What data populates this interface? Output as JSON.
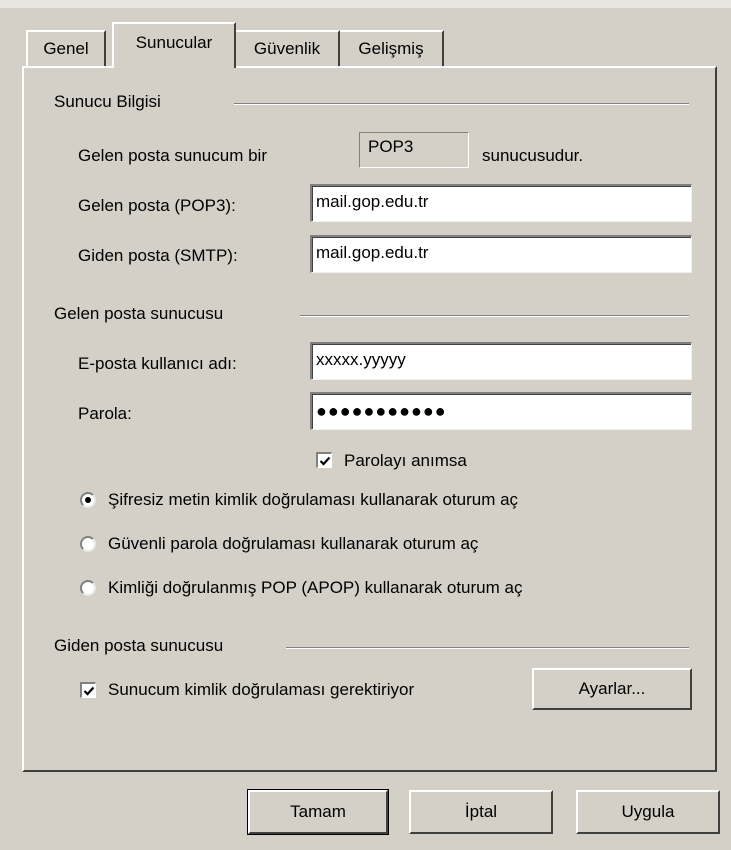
{
  "tabs": [
    {
      "label": "Genel",
      "active": false
    },
    {
      "label": "Sunucular",
      "active": true
    },
    {
      "label": "Güvenlik",
      "active": false
    },
    {
      "label": "Gelişmiş",
      "active": false
    }
  ],
  "server_info": {
    "heading": "Sunucu Bilgisi",
    "incoming_type_prefix": "Gelen posta sunucum bir",
    "incoming_type_value": "POP3",
    "incoming_type_suffix": "sunucusudur.",
    "incoming_label": "Gelen posta (POP3):",
    "incoming_value": "mail.gop.edu.tr",
    "outgoing_label": "Giden posta (SMTP):",
    "outgoing_value": "mail.gop.edu.tr"
  },
  "incoming_server": {
    "heading": "Gelen posta sunucusu",
    "username_label": "E-posta kullanıcı adı:",
    "username_value": "xxxxx.yyyyy",
    "password_label": "Parola:",
    "password_value": "●●●●●●●●●●●",
    "remember_label": "Parolayı anımsa",
    "remember_checked": true,
    "auth_options": [
      {
        "label": "Şifresiz metin kimlik doğrulaması kullanarak oturum aç",
        "selected": true
      },
      {
        "label": "Güvenli parola doğrulaması kullanarak oturum aç",
        "selected": false
      },
      {
        "label": "Kimliği doğrulanmış POP (APOP) kullanarak oturum aç",
        "selected": false
      }
    ]
  },
  "outgoing_server": {
    "heading": "Giden posta sunucusu",
    "requires_auth_label": "Sunucum kimlik doğrulaması gerektiriyor",
    "requires_auth_checked": true,
    "settings_button": "Ayarlar..."
  },
  "footer": {
    "ok_button": "Tamam",
    "cancel_button": "İptal",
    "apply_button": "Uygula"
  }
}
